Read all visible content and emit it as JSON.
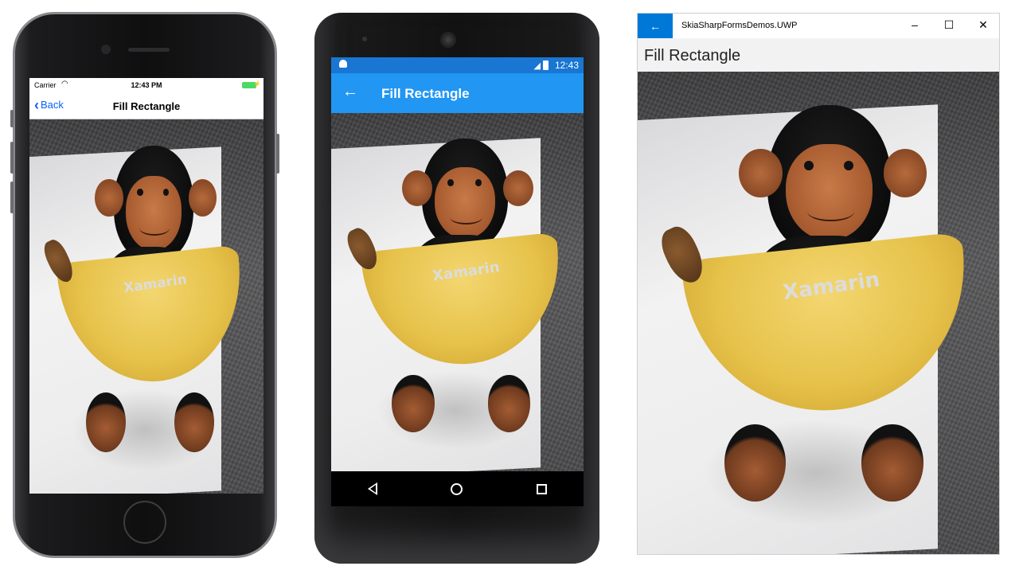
{
  "ios": {
    "status": {
      "carrier": "Carrier",
      "time": "12:43 PM"
    },
    "nav": {
      "back_label": "Back",
      "title": "Fill Rectangle"
    }
  },
  "android": {
    "status": {
      "time": "12:43"
    },
    "appbar": {
      "title": "Fill Rectangle"
    }
  },
  "uwp": {
    "window_title": "SkiaSharpFormsDemos.UWP",
    "page_title": "Fill Rectangle",
    "controls": {
      "minimize": "–",
      "maximize": "☐",
      "close": "✕"
    }
  },
  "photo": {
    "shirt_text": "Xamarin"
  },
  "colors": {
    "ios_accent": "#0a60ff",
    "android_primary": "#2196f3",
    "android_status": "#1976d2",
    "uwp_accent": "#0078d7"
  }
}
